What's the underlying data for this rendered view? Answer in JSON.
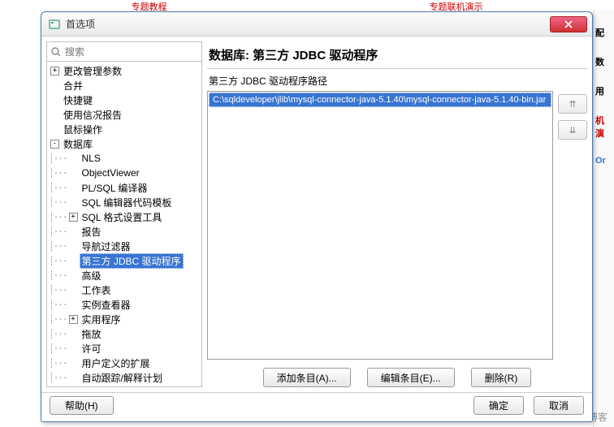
{
  "bg": {
    "t1": "专题教程",
    "t2": "专题联机演示",
    "r1": "配",
    "r2": "数",
    "r3": "用",
    "r4": "机演",
    "r5": "Or"
  },
  "watermark": "@ITPUB博客",
  "dialog": {
    "title": "首选项",
    "search_placeholder": "搜索"
  },
  "tree": [
    {
      "d": 0,
      "exp": "+",
      "label": "更改管理参数"
    },
    {
      "d": 0,
      "exp": "",
      "label": "合并"
    },
    {
      "d": 0,
      "exp": "",
      "label": "快捷键"
    },
    {
      "d": 0,
      "exp": "",
      "label": "使用信况报告"
    },
    {
      "d": 0,
      "exp": "",
      "label": "鼠标操作"
    },
    {
      "d": 0,
      "exp": "-",
      "label": "数据库"
    },
    {
      "d": 1,
      "exp": "",
      "label": "NLS"
    },
    {
      "d": 1,
      "exp": "",
      "label": "ObjectViewer"
    },
    {
      "d": 1,
      "exp": "",
      "label": "PL/SQL 编译器"
    },
    {
      "d": 1,
      "exp": "",
      "label": "SQL 编辑器代码模板"
    },
    {
      "d": 1,
      "exp": "+",
      "label": "SQL 格式设置工具"
    },
    {
      "d": 1,
      "exp": "",
      "label": "报告"
    },
    {
      "d": 1,
      "exp": "",
      "label": "导航过滤器"
    },
    {
      "d": 1,
      "exp": "",
      "label": "第三方 JDBC 驱动程序",
      "sel": true
    },
    {
      "d": 1,
      "exp": "",
      "label": "高级"
    },
    {
      "d": 1,
      "exp": "",
      "label": "工作表"
    },
    {
      "d": 1,
      "exp": "",
      "label": "实例查看器"
    },
    {
      "d": 1,
      "exp": "+",
      "label": "实用程序"
    },
    {
      "d": 1,
      "exp": "",
      "label": "拖放"
    },
    {
      "d": 1,
      "exp": "",
      "label": "许可"
    },
    {
      "d": 1,
      "exp": "",
      "label": "用户定义的扩展"
    },
    {
      "d": 1,
      "exp": "",
      "label": "自动跟踪/解释计划"
    }
  ],
  "panel": {
    "heading": "数据库: 第三方 JDBC 驱动程序",
    "subheading": "第三方 JDBC 驱动程序路径",
    "entry": "C:\\sqldeveloper\\jlib\\mysql-connector-java-5.1.40\\mysql-connector-java-5.1.40-bin.jar",
    "move_up": "⇈",
    "move_down": "⇊",
    "add": "添加条目(A)...",
    "edit": "编辑条目(E)...",
    "delete": "删除(R)"
  },
  "footer": {
    "help": "帮助(H)",
    "ok": "确定",
    "cancel": "取消"
  }
}
